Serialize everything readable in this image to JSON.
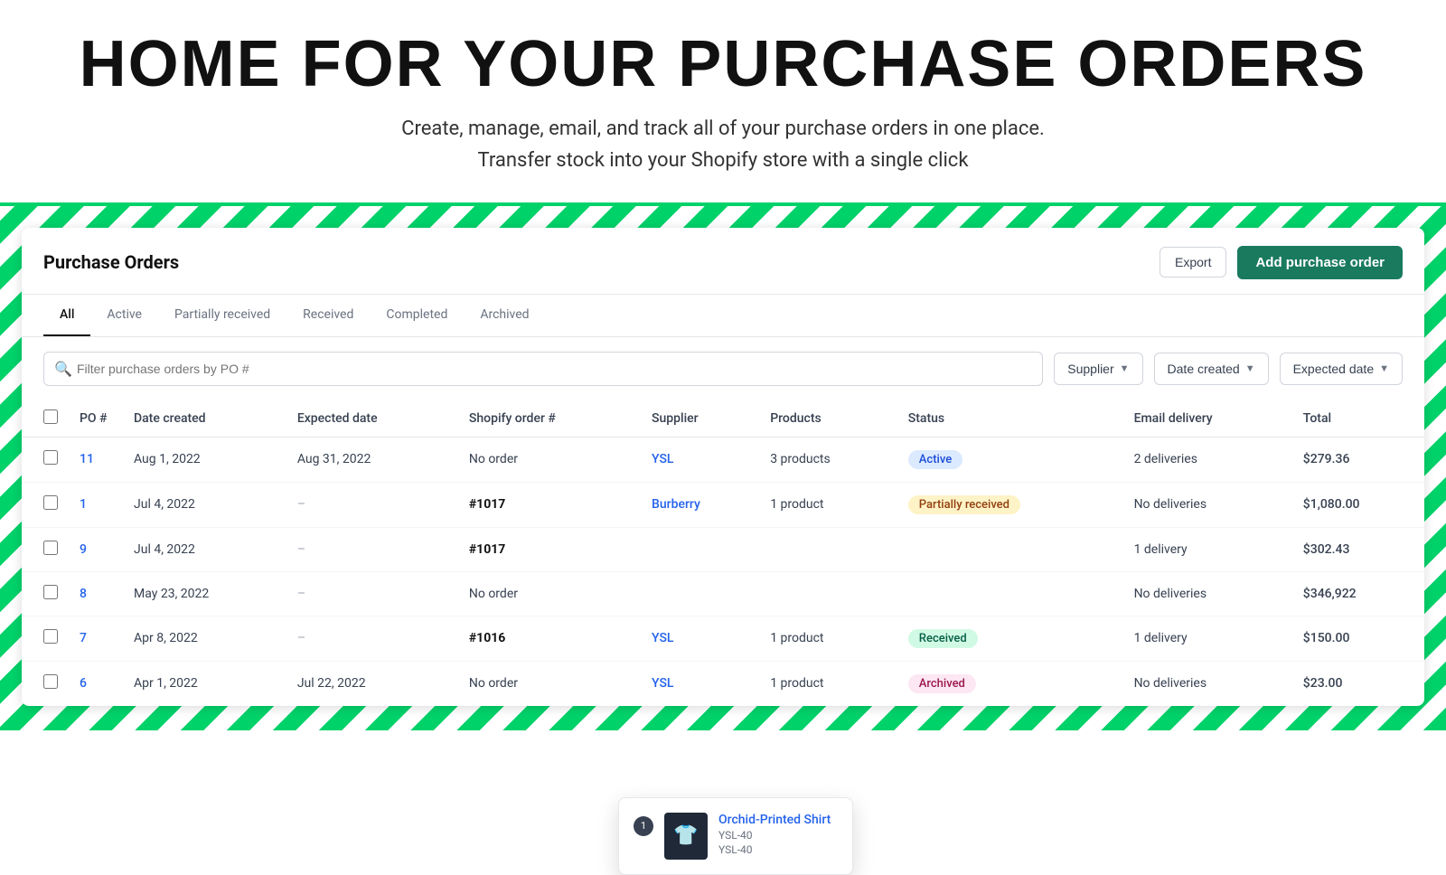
{
  "hero": {
    "title": "HOME  FOR  YOUR  PURCHASE  ORDERS",
    "subtitle_line1": "Create, manage, email, and track all of your purchase orders in one place.",
    "subtitle_line2": "Transfer stock into your Shopify store with a single click"
  },
  "card": {
    "title": "Purchase Orders",
    "export_label": "Export",
    "add_label": "Add purchase order"
  },
  "tabs": [
    {
      "label": "All",
      "active": true
    },
    {
      "label": "Active",
      "active": false
    },
    {
      "label": "Partially received",
      "active": false
    },
    {
      "label": "Received",
      "active": false
    },
    {
      "label": "Completed",
      "active": false
    },
    {
      "label": "Archived",
      "active": false
    }
  ],
  "filters": {
    "search_placeholder": "Filter purchase orders by PO #",
    "supplier_label": "Supplier",
    "date_created_label": "Date created",
    "expected_date_label": "Expected date"
  },
  "table": {
    "headers": [
      "",
      "PO #",
      "Date created",
      "Expected date",
      "Shopify order #",
      "Supplier",
      "Products",
      "Status",
      "Email delivery",
      "Total"
    ],
    "rows": [
      {
        "po": "11",
        "date_created": "Aug 1, 2022",
        "expected_date": "Aug 31, 2022",
        "shopify_order": "No order",
        "supplier": "YSL",
        "products": "3 products",
        "status": "Active",
        "status_type": "active",
        "email_delivery": "2 deliveries",
        "total": "$279.36"
      },
      {
        "po": "1",
        "date_created": "Jul 4, 2022",
        "expected_date": "–",
        "shopify_order": "#1017",
        "supplier": "Burberry",
        "products": "1 product",
        "status": "Partially received",
        "status_type": "partial",
        "email_delivery": "No deliveries",
        "total": "$1,080.00"
      },
      {
        "po": "9",
        "date_created": "Jul 4, 2022",
        "expected_date": "–",
        "shopify_order": "#1017",
        "supplier": "",
        "products": "",
        "status": "",
        "status_type": "",
        "email_delivery": "1 delivery",
        "total": "$302.43"
      },
      {
        "po": "8",
        "date_created": "May 23, 2022",
        "expected_date": "–",
        "shopify_order": "No order",
        "supplier": "",
        "products": "",
        "status": "",
        "status_type": "",
        "email_delivery": "No deliveries",
        "total": "$346,922"
      },
      {
        "po": "7",
        "date_created": "Apr 8, 2022",
        "expected_date": "–",
        "shopify_order": "#1016",
        "supplier": "YSL",
        "products": "1 product",
        "status": "Received",
        "status_type": "received",
        "email_delivery": "1 delivery",
        "total": "$150.00"
      },
      {
        "po": "6",
        "date_created": "Apr 1, 2022",
        "expected_date": "Jul 22, 2022",
        "shopify_order": "No order",
        "supplier": "YSL",
        "products": "1 product",
        "status": "Archived",
        "status_type": "archived",
        "email_delivery": "No deliveries",
        "total": "$23.00"
      }
    ]
  },
  "tooltip": {
    "badge_count": "1",
    "product_name": "Orchid-Printed Shirt",
    "sku1": "YSL-40",
    "sku2": "YSL-40",
    "icon": "👕"
  }
}
